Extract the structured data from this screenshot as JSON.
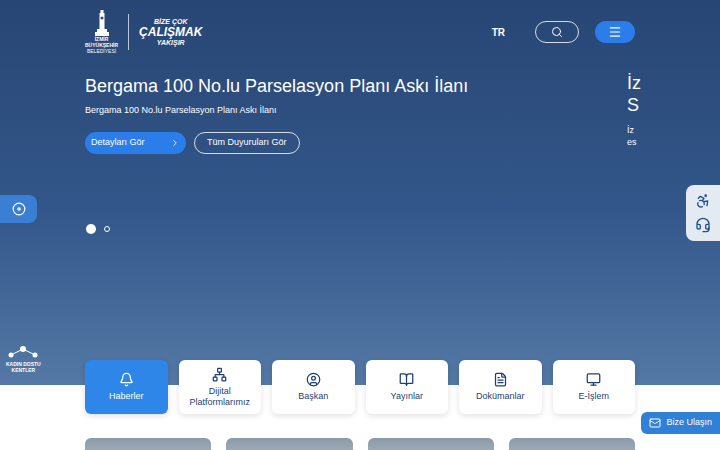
{
  "header": {
    "logo": {
      "city": "İZMİR",
      "line1": "BÜYÜKŞEHİR",
      "line2": "BELEDİYESİ"
    },
    "slogan": [
      "BİZE ÇOK",
      "ÇALIŞMAK",
      "YAKIŞIR"
    ],
    "language": "TR"
  },
  "slider": {
    "title": "Bergama 100 No.lu Parselasyon Planı Askı İlanı",
    "description": "Bergama 100 No.lu Parselasyon Planı Askı İlanı",
    "buttons": [
      {
        "label": "Detayları Gör",
        "kind": "primary"
      },
      {
        "label": "Tüm Duyuruları Gör",
        "kind": "outline"
      }
    ],
    "dots": [
      {
        "selected": true
      },
      {
        "selected": false
      }
    ],
    "next_slide": {
      "title": [
        "İz",
        "S"
      ],
      "description": [
        "İz",
        "es"
      ]
    }
  },
  "badge": {
    "lines": [
      "KADIN DOSTU",
      "KENTLER"
    ]
  },
  "quick_links": [
    {
      "label": "Haberler",
      "selected": true
    },
    {
      "label": "Dijital Platformlarımız",
      "selected": false
    },
    {
      "label": "Başkan",
      "selected": false
    },
    {
      "label": "Yayınlar",
      "selected": false
    },
    {
      "label": "Dokümanlar",
      "selected": false
    },
    {
      "label": "E-İşlem",
      "selected": false
    }
  ],
  "contact_button": "Bize Ulaşın"
}
